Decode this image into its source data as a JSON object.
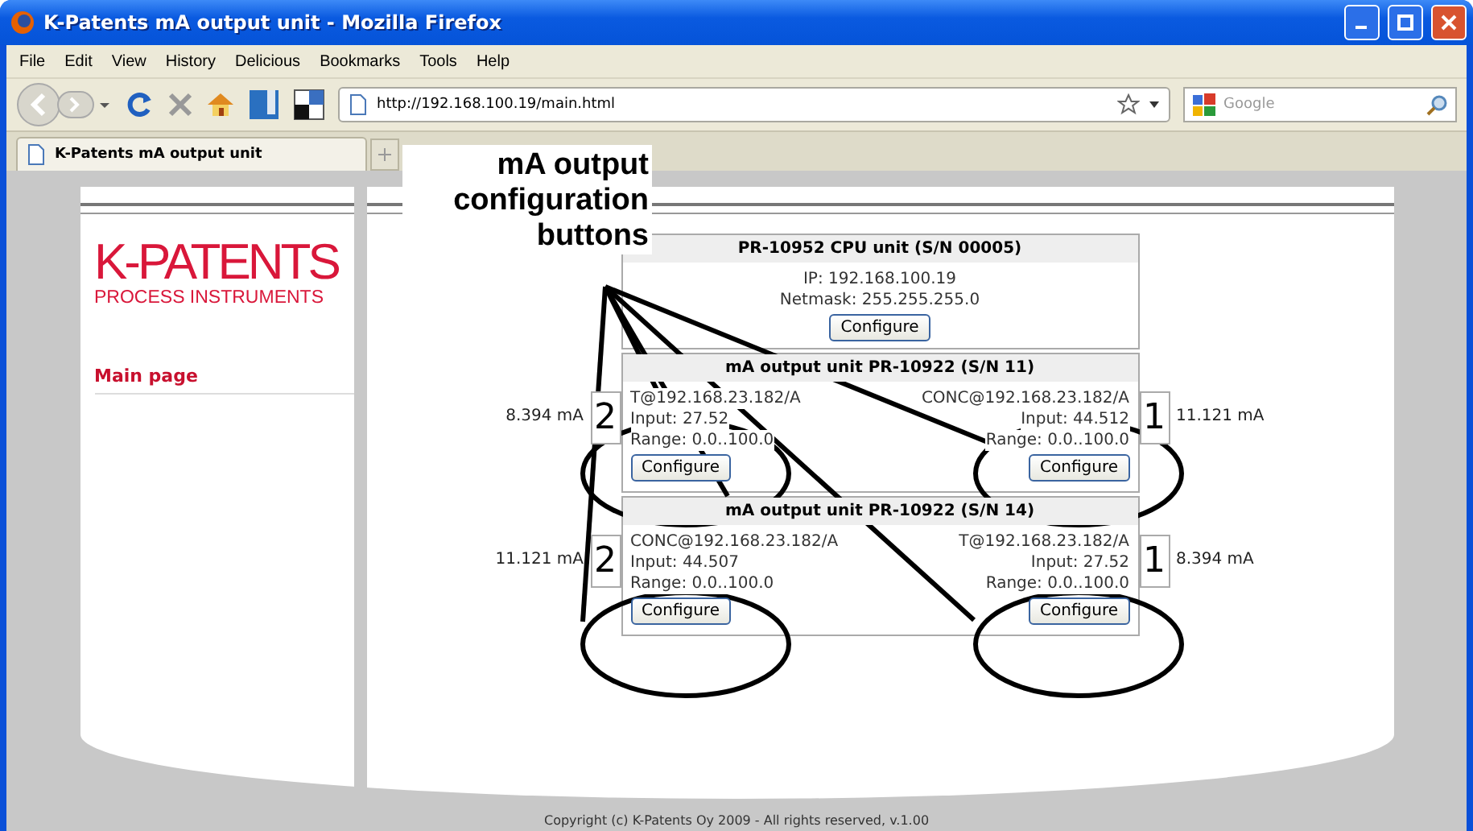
{
  "window": {
    "title": "K-Patents mA output unit - Mozilla Firefox"
  },
  "menu": [
    "File",
    "Edit",
    "View",
    "History",
    "Delicious",
    "Bookmarks",
    "Tools",
    "Help"
  ],
  "address": {
    "value": "http://192.168.100.19/main.html"
  },
  "search": {
    "placeholder": "Google"
  },
  "tabs": [
    {
      "label": "K-Patents mA output unit",
      "selected": true
    }
  ],
  "callout": {
    "lines": [
      "mA output",
      "configuration",
      "buttons"
    ]
  },
  "sidebar": {
    "logo": "K-PATENTS",
    "tagline": "PROCESS INSTRUMENTS",
    "nav": [
      {
        "label": "Main page",
        "selected": true
      }
    ]
  },
  "cpu_unit": {
    "title": "PR-10952 CPU unit (S/N 00005)",
    "ip": "IP: 192.168.100.19",
    "netmask": "Netmask: 255.255.255.0",
    "button": "Configure"
  },
  "ma_units": [
    {
      "title": "mA output unit PR-10922 (S/N 11)",
      "channels": [
        {
          "number": "2",
          "reading": "8.394 mA",
          "source": "T@192.168.23.182/A",
          "input": "Input: 27.52",
          "range": "Range: 0.0..100.0",
          "button": "Configure"
        },
        {
          "number": "1",
          "reading": "11.121 mA",
          "source": "CONC@192.168.23.182/A",
          "input": "Input: 44.512",
          "range": "Range: 0.0..100.0",
          "button": "Configure"
        }
      ]
    },
    {
      "title": "mA output unit PR-10922 (S/N 14)",
      "channels": [
        {
          "number": "2",
          "reading": "11.121 mA",
          "source": "CONC@192.168.23.182/A",
          "input": "Input: 44.507",
          "range": "Range: 0.0..100.0",
          "button": "Configure"
        },
        {
          "number": "1",
          "reading": "8.394 mA",
          "source": "T@192.168.23.182/A",
          "input": "Input: 27.52",
          "range": "Range: 0.0..100.0",
          "button": "Configure"
        }
      ]
    }
  ],
  "footer": "Copyright (c) K-Patents Oy 2009 - All rights reserved, v.1.00"
}
